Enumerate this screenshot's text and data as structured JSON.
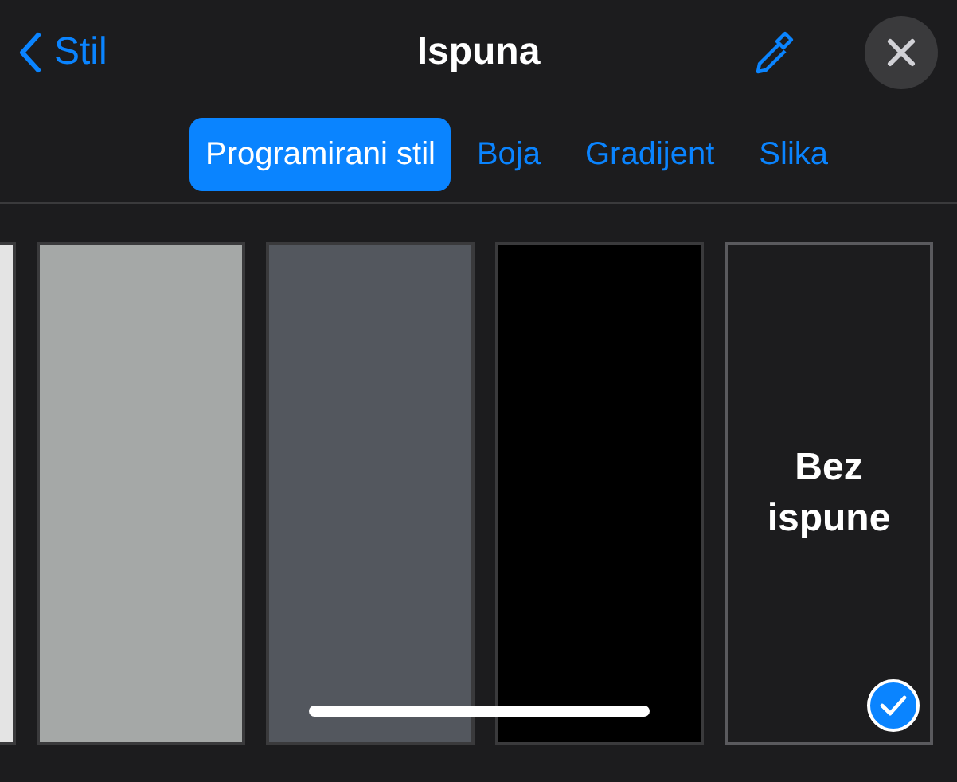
{
  "header": {
    "back_label": "Stil",
    "title": "Ispuna"
  },
  "tabs": [
    {
      "label": "Programirani stil",
      "selected": true
    },
    {
      "label": "Boja",
      "selected": false
    },
    {
      "label": "Gradijent",
      "selected": false
    },
    {
      "label": "Slika",
      "selected": false
    }
  ],
  "swatches": [
    {
      "kind": "color",
      "color": "#e4e4e4",
      "selected": false
    },
    {
      "kind": "color",
      "color": "#a5a8a7",
      "selected": false
    },
    {
      "kind": "color",
      "color": "#53575e",
      "selected": false
    },
    {
      "kind": "color",
      "color": "#000000",
      "selected": false
    },
    {
      "kind": "none",
      "label": "Bez ispune",
      "selected": true
    }
  ]
}
